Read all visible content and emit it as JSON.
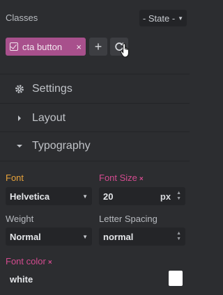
{
  "classes": {
    "label": "Classes",
    "state_label": "- State -",
    "chip": {
      "label": "cta button",
      "close": "×"
    },
    "add_label": "+"
  },
  "sections": {
    "settings": "Settings",
    "layout": "Layout",
    "typography": "Typography"
  },
  "typography": {
    "font_label": "Font",
    "font_value": "Helvetica",
    "font_size_label": "Font Size",
    "font_size_value": "20",
    "font_size_unit": "px",
    "weight_label": "Weight",
    "weight_value": "Normal",
    "letter_spacing_label": "Letter Spacing",
    "letter_spacing_value": "normal",
    "font_color_label": "Font color",
    "font_color_value": "white",
    "clear_mark": "×",
    "swatch_color": "#ffffff"
  },
  "colors": {
    "background": "#2c2d30",
    "chip": "#a8508c",
    "accent_orange": "#e8a33b",
    "accent_pink": "#d34b8f"
  }
}
